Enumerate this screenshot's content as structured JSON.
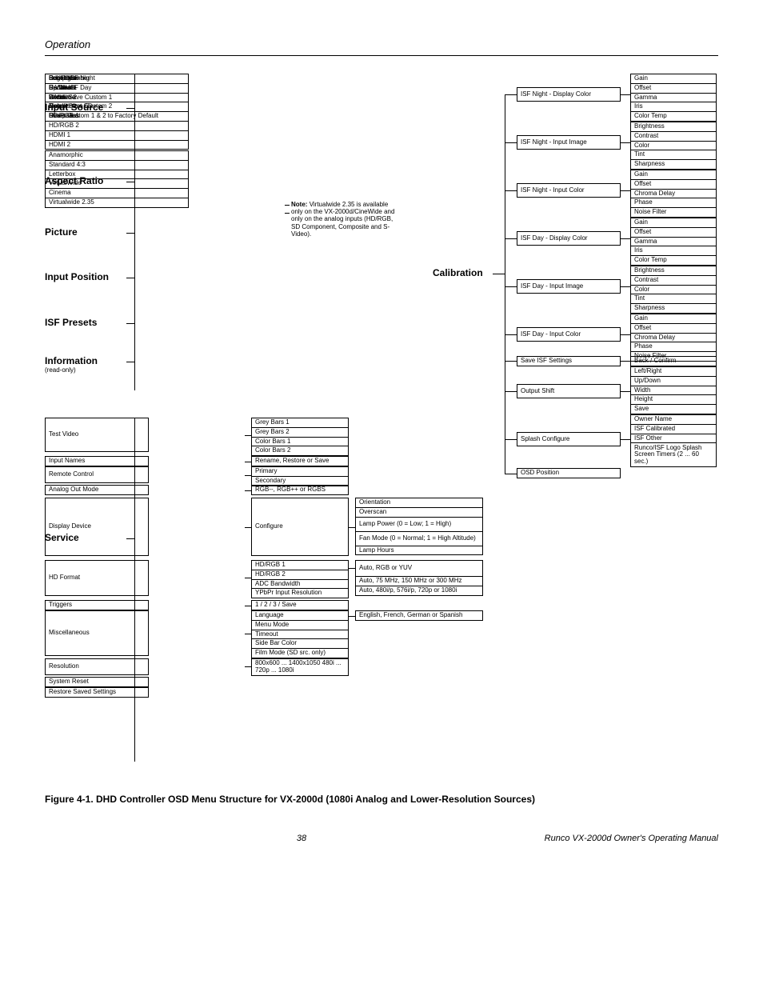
{
  "header": {
    "section": "Operation"
  },
  "left": {
    "input_source": {
      "label": "Input Source",
      "items": [
        "Composite",
        "S-Video 1",
        "S-Video 2",
        "Component SD",
        "HD/RGB 1",
        "HD/RGB 2",
        "HDMI 1",
        "HDMI 2"
      ]
    },
    "aspect_ratio": {
      "label": "Aspect Ratio",
      "items": [
        "Anamorphic",
        "Standard 4:3",
        "Letterbox",
        "VirtualWide",
        "Cinema",
        "Virtualwide 2.35"
      ]
    },
    "picture": {
      "label": "Picture",
      "items": [
        "Brightness",
        "Contrast",
        "Color",
        "Tint",
        "Sharpness"
      ]
    },
    "input_position": {
      "label": "Input Position",
      "items": [
        "Left/Right",
        "Up/Down",
        "Width",
        "Height",
        "Overscan"
      ]
    },
    "isf_presets": {
      "label": "ISF Presets",
      "items": [
        "Recall ISF Night",
        "Recall ISF Day",
        "Recall/Save Custom 1",
        "Recall/Save Custom 2",
        "Reset Custom 1 & 2 to Factory Default"
      ]
    },
    "information": {
      "label": "Information",
      "sublabel": "(read-only)",
      "items": [
        "Serial Number",
        "Hardware",
        "Firmware",
        "Date"
      ]
    }
  },
  "note": "Note: Virtualwide 2.35 is available only on the VX-2000d/CineWide and only on the analog inputs (HD/RGB, SD Component, Composite and S-Video).",
  "calibration": {
    "label": "Calibration",
    "groups": {
      "isf_night_display_color": {
        "label": "ISF Night - Display Color",
        "items": [
          "Gain",
          "Offset",
          "Gamma",
          "Iris",
          "Color Temp"
        ]
      },
      "isf_night_input_image": {
        "label": "ISF Night - Input Image",
        "items": [
          "Brightness",
          "Contrast",
          "Color",
          "Tint",
          "Sharpness"
        ]
      },
      "isf_night_input_color": {
        "label": "ISF Night - Input Color",
        "items": [
          "Gain",
          "Offset",
          "Chroma Delay",
          "Phase",
          "Noise Filter"
        ]
      },
      "isf_day_display_color": {
        "label": "ISF Day - Display Color",
        "items": [
          "Gain",
          "Offset",
          "Gamma",
          "Iris",
          "Color Temp"
        ]
      },
      "isf_day_input_image": {
        "label": "ISF Day - Input Image",
        "items": [
          "Brightness",
          "Contrast",
          "Color",
          "Tint",
          "Sharpness"
        ]
      },
      "isf_day_input_color": {
        "label": "ISF Day - Input Color",
        "items": [
          "Gain",
          "Offset",
          "Chroma Delay",
          "Phase",
          "Noise Filter"
        ]
      },
      "save_isf": {
        "label": "Save ISF Settings",
        "items": [
          "Back / Confirm"
        ]
      },
      "output_shift": {
        "label": "Output Shift",
        "items": [
          "Left/Right",
          "Up/Down",
          "Width",
          "Height",
          "Save"
        ]
      },
      "splash_configure": {
        "label": "Splash Configure",
        "items": [
          "Owner Name",
          "ISF Calibrated",
          "ISF Other",
          "Runco/ISF Logo Splash Screen Timers (2 ... 60 sec.)"
        ]
      },
      "osd_position": {
        "label": "OSD Position",
        "items": []
      }
    }
  },
  "service": {
    "label": "Service",
    "rows": {
      "test_video": {
        "label": "Test Video",
        "items": [
          "Grey Bars 1",
          "Grey Bars 2",
          "Color Bars 1",
          "Color Bars 2"
        ]
      },
      "input_names": {
        "label": "Input Names",
        "items": [
          "Rename, Restore or Save"
        ]
      },
      "remote_control": {
        "label": "Remote Control",
        "items": [
          "Primary",
          "Secondary"
        ]
      },
      "analog_out_mode": {
        "label": "Analog Out Mode",
        "items": [
          "RGB--, RGB++ or RGBS"
        ]
      },
      "display_device": {
        "label": "Display Device",
        "sub1": "Configure",
        "items": [
          "Orientation",
          "Overscan",
          "Lamp Power (0 = Low; 1 = High)",
          "Fan Mode (0 = Normal; 1 = High Altitude)",
          "Lamp Hours"
        ]
      },
      "hd_format": {
        "label": "HD Format",
        "sub": [
          "HD/RGB 1",
          "HD/RGB 2",
          "ADC Bandwidth",
          "YPbPr Input Resolution"
        ],
        "vals": [
          "Auto, RGB or YUV",
          "Auto, 75 MHz, 150 MHz or 300 MHz",
          "Auto, 480i/p, 576i/p, 720p or 1080i"
        ]
      },
      "triggers": {
        "label": "Triggers",
        "items": [
          "1 / 2 / 3 / Save"
        ]
      },
      "miscellaneous": {
        "label": "Miscellaneous",
        "sub": [
          "Language",
          "Menu Mode",
          "Timeout",
          "Side Bar Color",
          "Film Mode (SD src. only)"
        ],
        "vals": [
          "English, French, German or Spanish"
        ]
      },
      "resolution": {
        "label": "Resolution",
        "items": [
          "800x600 ... 1400x1050 480i ... 720p ... 1080i"
        ]
      },
      "system_reset": {
        "label": "System Reset"
      },
      "restore_saved": {
        "label": "Restore Saved Settings"
      }
    }
  },
  "figure_caption": "Figure 4-1. DHD Controller OSD Menu Structure for VX-2000d (1080i Analog and Lower-Resolution Sources)",
  "footer": {
    "page": "38",
    "right": "Runco VX-2000d Owner's Operating Manual"
  }
}
